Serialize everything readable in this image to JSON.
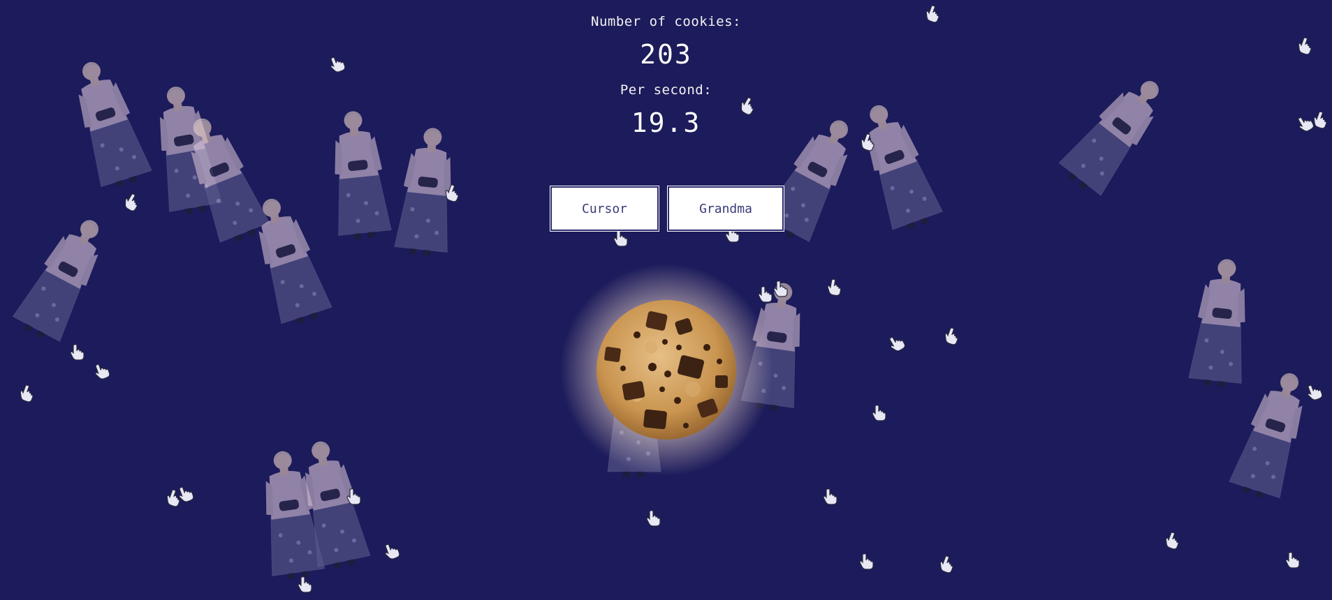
{
  "game": {
    "cookies_label": "Number of cookies:",
    "cookies_value": "203",
    "per_second_label": "Per second:",
    "per_second_value": "19.3"
  },
  "shop": {
    "cursor_label": "Cursor",
    "grandma_label": "Grandma"
  },
  "colors": {
    "background": "#1c1b5b",
    "text": "#ffffff",
    "button_bg": "#ffffff",
    "button_text": "#3a3a7a"
  },
  "icons": {
    "cookie": "chocolate-chip-cookie",
    "cursor": "pointing-hand-cursor",
    "grandma": "grandma-figure"
  }
}
